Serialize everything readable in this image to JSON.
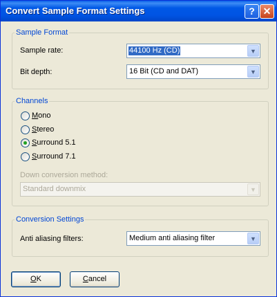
{
  "window": {
    "title": "Convert Sample Format Settings",
    "help_glyph": "?",
    "close_glyph": "✕"
  },
  "sample_format": {
    "legend": "Sample Format",
    "sample_rate_label": "Sample rate:",
    "sample_rate_value": "44100 Hz (CD)",
    "bit_depth_label": "Bit depth:",
    "bit_depth_value": "16 Bit (CD and DAT)"
  },
  "channels": {
    "legend": "Channels",
    "options": [
      {
        "first": "M",
        "rest": "ono",
        "selected": false
      },
      {
        "first": "S",
        "rest": "tereo",
        "selected": false
      },
      {
        "first": "S",
        "rest": "urround 5.1",
        "selected": true
      },
      {
        "first": "S",
        "rest": "urround 7.1",
        "selected": false
      }
    ],
    "down_conversion_label": "Down conversion method:",
    "down_conversion_value": "Standard downmix"
  },
  "conversion": {
    "legend": "Conversion Settings",
    "anti_aliasing_label": "Anti aliasing filters:",
    "anti_aliasing_value": "Medium anti aliasing filter"
  },
  "buttons": {
    "ok_first": "O",
    "ok_rest": "K",
    "cancel_first": "C",
    "cancel_rest": "ancel"
  },
  "icons": {
    "dropdown": "chevron-down-icon",
    "help": "help-icon",
    "close": "close-icon"
  }
}
